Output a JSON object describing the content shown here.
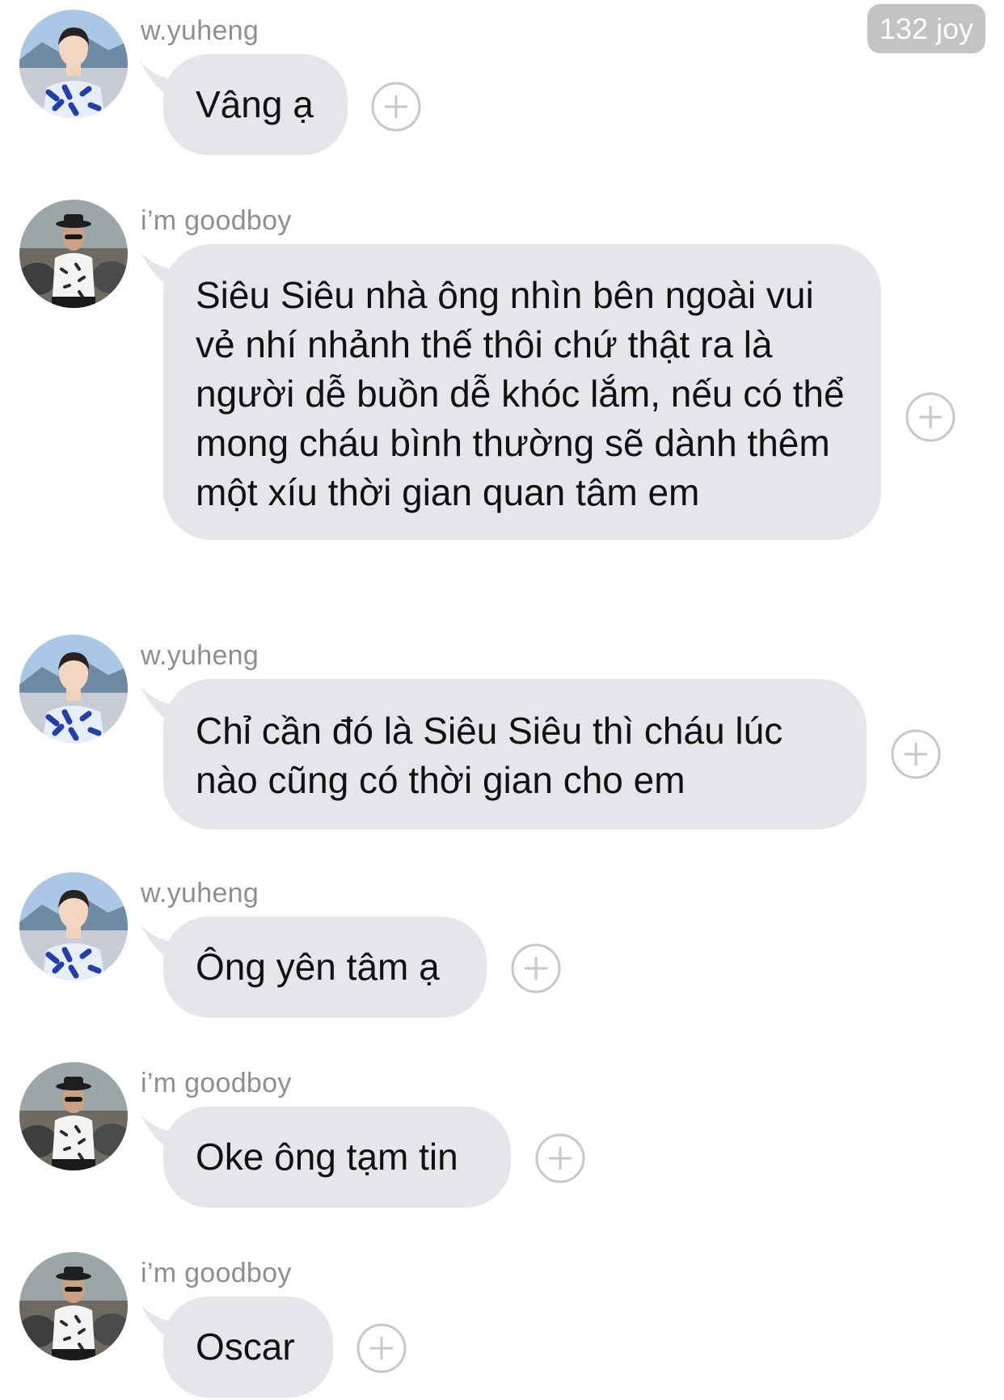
{
  "header": {
    "count_badge": "132 joy"
  },
  "messages": [
    {
      "sender": "w.yuheng",
      "avatar": "avatar-wyuheng",
      "text": "Vâng ạ"
    },
    {
      "sender": "i’m goodboy",
      "avatar": "avatar-goodboy",
      "text": "Siêu Siêu nhà ông nhìn bên ngoài vui vẻ nhí nhảnh thế thôi chứ thật ra là người dễ buồn dễ khóc lắm, nếu có thể mong cháu bình thường sẽ dành thêm một xíu thời gian quan tâm em"
    },
    {
      "sender": "w.yuheng",
      "avatar": "avatar-wyuheng",
      "text": "Chỉ cần đó là Siêu Siêu thì cháu lúc nào cũng có thời gian cho em"
    },
    {
      "sender": "w.yuheng",
      "avatar": "avatar-wyuheng",
      "text": "Ông yên tâm ạ"
    },
    {
      "sender": "i’m goodboy",
      "avatar": "avatar-goodboy",
      "text": "Oke ông tạm tin"
    },
    {
      "sender": "i’m goodboy",
      "avatar": "avatar-goodboy",
      "text": "Oscar"
    }
  ],
  "icons": {
    "add_reaction": "plus-circle-icon"
  },
  "colors": {
    "bubble": "#e5e6ea",
    "badge": "#c3c3c6",
    "sender_name": "#8e8e93",
    "text": "#111111"
  }
}
